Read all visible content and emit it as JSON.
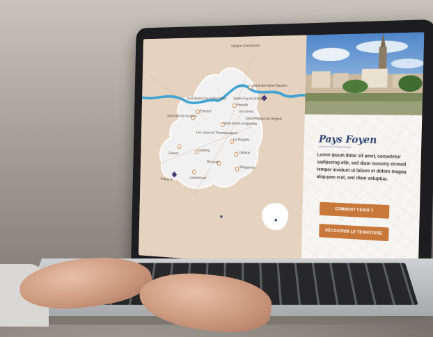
{
  "brand": {
    "title": "Pays Foyen"
  },
  "content": {
    "paragraph": "Lorem ipsum dolor sit amet, consetetur sadipscing elitr, sed diam nonumy eirmod tempor invidunt ut labore et dolore magna aliquyam erat, sed diam voluptua."
  },
  "buttons": {
    "primary": "Comment venir ?",
    "secondary": "Découvrir le territoire"
  },
  "map": {
    "places": [
      {
        "label": "Vérigne-Gensefrané"
      },
      {
        "label": "Saint-Avit-Saint-Nazaire"
      },
      {
        "label": "Port-Sainte-Foy-et-Ponchapt"
      },
      {
        "label": "Sainte-Foy-la-Grande"
      },
      {
        "label": "Pineuilh"
      },
      {
        "label": "Les Lèves"
      },
      {
        "label": "Eynesse"
      },
      {
        "label": "Saint-Philippe-du-Seignal"
      },
      {
        "label": "Saint-André-et-Appelles"
      },
      {
        "label": "Saint-Avit-de-Soulège"
      },
      {
        "label": "Les Lèves-et-Thoumeyragues"
      },
      {
        "label": "La Roquille"
      },
      {
        "label": "Gensac"
      },
      {
        "label": "Ligueux"
      },
      {
        "label": "Caplong"
      },
      {
        "label": "Riocaud"
      },
      {
        "label": "Landerrouat"
      },
      {
        "label": "Margueron"
      },
      {
        "label": "Pellegrue"
      }
    ]
  },
  "colors": {
    "accent": "#c8783a",
    "brand": "#2e3f74",
    "river": "#3fa3d4",
    "map_bg": "#e6d3bf"
  }
}
